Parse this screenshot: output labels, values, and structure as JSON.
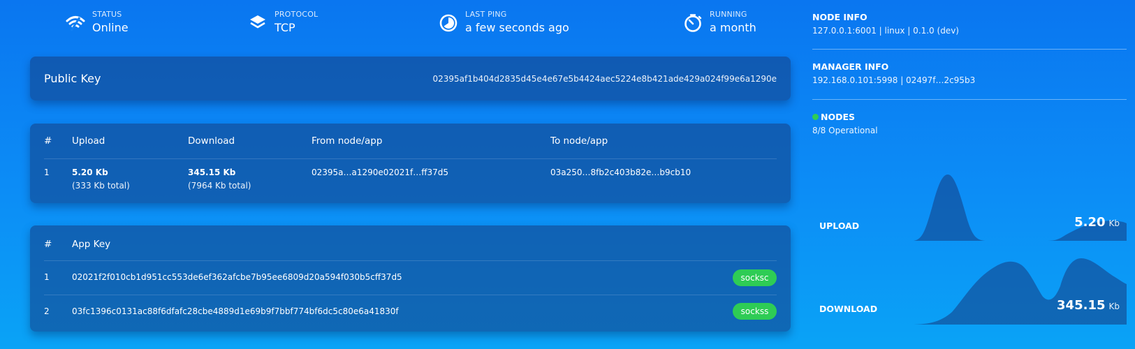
{
  "status_bar": [
    {
      "label": "STATUS",
      "value": "Online",
      "icon": "wifi-icon"
    },
    {
      "label": "PROTOCOL",
      "value": "TCP",
      "icon": "layers-icon"
    },
    {
      "label": "LAST PING",
      "value": "a few seconds ago",
      "icon": "pie-clock-icon"
    },
    {
      "label": "RUNNING",
      "value": "a month",
      "icon": "stopwatch-icon"
    }
  ],
  "public_key": {
    "title": "Public Key",
    "value": "02395af1b404d2835d45e4e67e5b4424aec5224e8b421ade429a024f99e6a1290e"
  },
  "transports": {
    "headers": [
      "#",
      "Upload",
      "Download",
      "From node/app",
      "To node/app"
    ],
    "rows": [
      {
        "index": "1",
        "upload": "5.20 Kb",
        "upload_total": "(333 Kb total)",
        "download": "345.15 Kb",
        "download_total": "(7964 Kb total)",
        "from": "02395a…a1290e02021f…ff37d5",
        "to": "03a250…8fb2c403b82e…b9cb10"
      }
    ]
  },
  "apps": {
    "headers": [
      "#",
      "App Key"
    ],
    "rows": [
      {
        "index": "1",
        "key": "02021f2f010cb1d951cc553de6ef362afcbe7b95ee6809d20a594f030b5cff37d5",
        "app": "socksc"
      },
      {
        "index": "2",
        "key": "03fc1396c0131ac88f6dfafc28cbe4889d1e69b9f7bbf774bf6dc5c80e6a41830f",
        "app": "sockss"
      }
    ]
  },
  "node_info": {
    "title": "NODE INFO",
    "value": "127.0.0.1:6001 | linux | 0.1.0 (dev)"
  },
  "manager_info": {
    "title": "MANAGER INFO",
    "value": "192.168.0.101:5998 | 02497f…2c95b3"
  },
  "nodes": {
    "title": "NODES",
    "value": "8/8 Operational",
    "status_color": "#2ecc55"
  },
  "upload_graph": {
    "label": "UPLOAD",
    "value": "5.20",
    "unit": "Kb"
  },
  "download_graph": {
    "label": "DOWNLOAD",
    "value": "345.15",
    "unit": "Kb"
  },
  "colors": {
    "badge": "#2ecc55",
    "graph_fill": "rgba(20, 70, 140, 0.62)"
  }
}
